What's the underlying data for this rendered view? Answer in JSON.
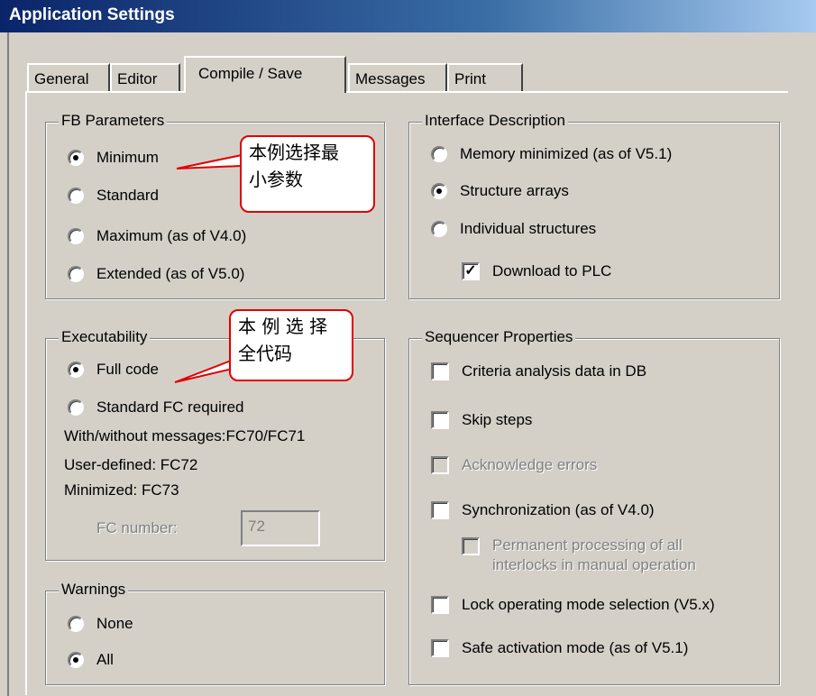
{
  "window": {
    "title": "Application Settings"
  },
  "tabs": [
    {
      "label": "General",
      "active": false
    },
    {
      "label": "Editor",
      "active": false
    },
    {
      "label": "Compile / Save",
      "active": true
    },
    {
      "label": "Messages",
      "active": false
    },
    {
      "label": "Print",
      "active": false
    }
  ],
  "fb_parameters": {
    "title": "FB Parameters",
    "options": [
      "Minimum",
      "Standard",
      "Maximum (as of V4.0)",
      "Extended (as of V5.0)"
    ],
    "selected": "Minimum"
  },
  "interface_description": {
    "title": "Interface Description",
    "options": [
      "Memory minimized (as of V5.1)",
      "Structure arrays",
      "Individual structures"
    ],
    "selected": "Structure arrays",
    "download_to_plc": {
      "label": "Download to PLC",
      "checked": true
    }
  },
  "executability": {
    "title": "Executability",
    "options": [
      "Full code",
      "Standard FC required"
    ],
    "selected": "Full code",
    "info": [
      "With/without messages:FC70/FC71",
      "User-defined: FC72",
      "Minimized: FC73"
    ],
    "fc_number": {
      "label": "FC number:",
      "value": "72"
    }
  },
  "warnings": {
    "title": "Warnings",
    "options": [
      "None",
      "All"
    ],
    "selected": "All"
  },
  "sequencer_properties": {
    "title": "Sequencer Properties",
    "items": [
      {
        "label": "Criteria analysis data in DB",
        "checked": false,
        "enabled": true
      },
      {
        "label": "Skip steps",
        "checked": false,
        "enabled": true
      },
      {
        "label": "Acknowledge errors",
        "checked": false,
        "enabled": false
      },
      {
        "label": "Synchronization (as of V4.0)",
        "checked": false,
        "enabled": true
      },
      {
        "label": "Permanent processing of all",
        "label2": "interlocks in manual operation",
        "checked": false,
        "enabled": false
      },
      {
        "label": "Lock operating mode selection (V5.x)",
        "checked": false,
        "enabled": true
      },
      {
        "label": "Safe activation mode (as of V5.1)",
        "checked": false,
        "enabled": true
      }
    ]
  },
  "annotations": [
    {
      "line1": "本例选择最",
      "line2": "小参数"
    },
    {
      "line1": "本 例 选 择",
      "line2": "全代码"
    }
  ],
  "colors": {
    "title_bar": "#0a246a",
    "callout_border": "#e00000",
    "dialog_bg": "#d4d0c8"
  }
}
